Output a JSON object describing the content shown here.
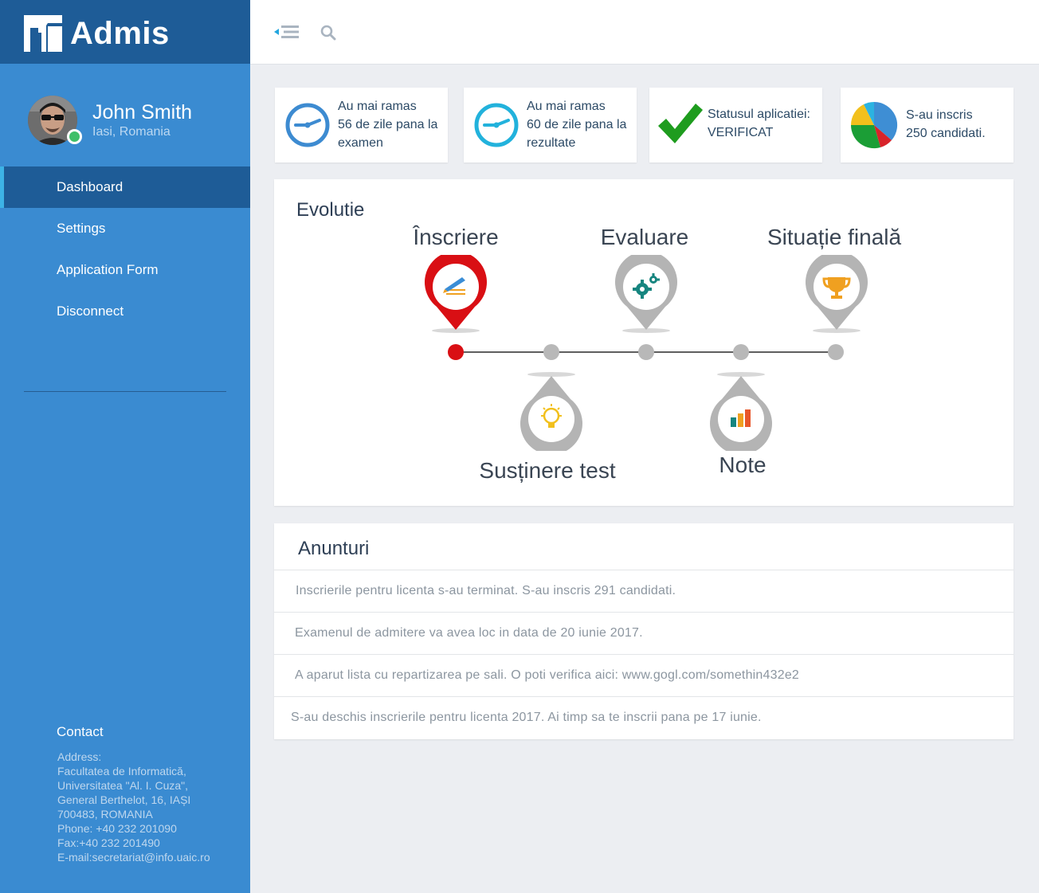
{
  "brand": {
    "name": "Admis"
  },
  "profile": {
    "name": "John Smith",
    "location": "Iasi, Romania"
  },
  "sidebar": {
    "items": [
      {
        "label": "Dashboard",
        "active": true
      },
      {
        "label": "Settings"
      },
      {
        "label": "Application Form"
      },
      {
        "label": "Disconnect"
      }
    ]
  },
  "contact": {
    "title": "Contact",
    "lines": [
      "Address:",
      "Facultatea de Informatică,",
      "Universitatea \"Al. I. Cuza\",",
      "General Berthelot, 16, IAȘI",
      "700483, ROMANIA",
      "Phone: +40 232 201090",
      "Fax:+40 232 201490",
      "E-mail:secretariat@info.uaic.ro"
    ]
  },
  "topbar": {
    "menu_icon": "menu-collapse-icon",
    "search_icon": "search-icon"
  },
  "stats": [
    {
      "lines": [
        "Au mai ramas",
        "56 de zile pana la",
        "examen"
      ],
      "icon": "clock-icon",
      "color": "#3d8bd1"
    },
    {
      "lines": [
        "Au mai ramas",
        "60 de zile pana la",
        "rezultate"
      ],
      "icon": "clock-icon",
      "color": "#22b2dc"
    },
    {
      "lines": [
        "Statusul aplicatiei:",
        "VERIFICAT"
      ],
      "icon": "checkmark-icon",
      "color": "#1e9c1e"
    },
    {
      "lines": [
        "S-au inscris",
        "250 candidati."
      ],
      "icon": "pie-chart-icon"
    }
  ],
  "evolutie": {
    "title": "Evolutie",
    "stages_top": [
      {
        "label": "Înscriere",
        "icon": "pencil-icon",
        "state": "active"
      },
      {
        "label": "Evaluare",
        "icon": "gears-icon",
        "state": "pending"
      },
      {
        "label": "Situație finală",
        "icon": "trophy-icon",
        "state": "pending"
      }
    ],
    "stages_bottom": [
      {
        "label": "Susținere test",
        "icon": "lightbulb-icon",
        "state": "pending"
      },
      {
        "label": "Note",
        "icon": "bar-chart-icon",
        "state": "pending"
      }
    ],
    "colors": {
      "active": "#d90f14",
      "pending": "#b4b4b4"
    }
  },
  "anunturi": {
    "title": "Anunturi",
    "items": [
      "Inscrierile pentru licenta s-au terminat. S-au inscris 291 candidati.",
      "Examenul de admitere va avea loc in data de 20 iunie 2017.",
      "A aparut lista cu repartizarea pe sali. O poti verifica aici: www.gogl.com/somethin432e2",
      "S-au deschis inscrierile pentru licenta 2017. Ai timp sa te inscrii pana pe 17 iunie."
    ]
  }
}
